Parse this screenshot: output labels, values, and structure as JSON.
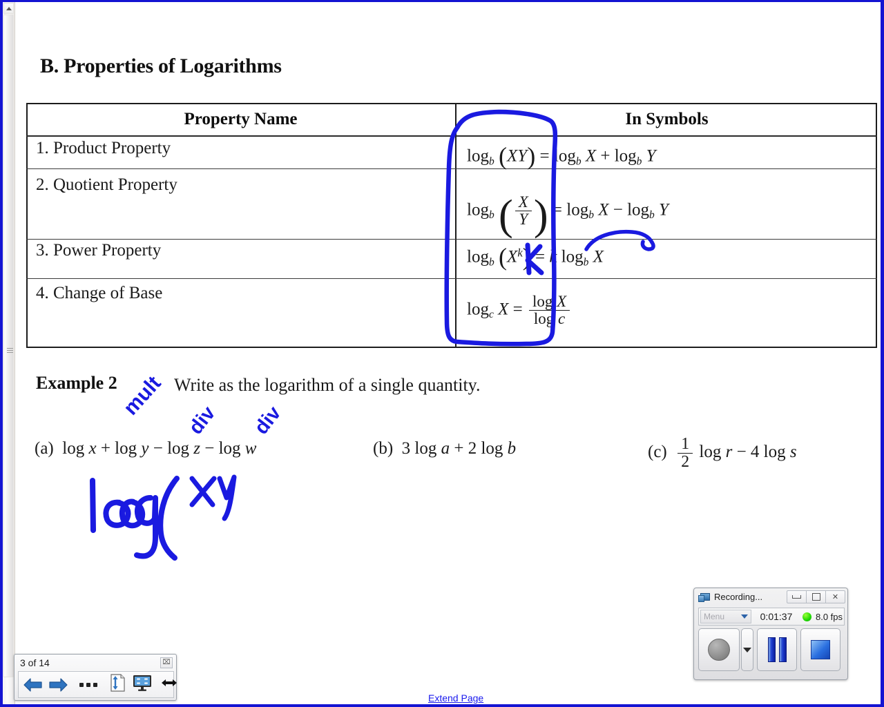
{
  "document": {
    "section_title": "B. Properties of Logarithms",
    "table": {
      "headers": [
        "Property Name",
        "In Symbols"
      ],
      "rows": [
        {
          "name": "1. Product Property",
          "symbols_plain": "log_b(XY) = log_b X + log_b Y"
        },
        {
          "name": "2. Quotient Property",
          "symbols_plain": "log_b(X/Y) = log_b X - log_b Y"
        },
        {
          "name": "3. Power Property",
          "symbols_plain": "log_b(X^k) = k log_b X"
        },
        {
          "name": "4. Change of Base",
          "symbols_plain": "log_c X = log X / log c"
        }
      ]
    },
    "example": {
      "label": "Example 2",
      "instruction": "Write as the logarithm of a single quantity.",
      "parts": [
        {
          "tag": "(a)",
          "expr_plain": "log x + log y - log z - log w"
        },
        {
          "tag": "(b)",
          "expr_plain": "3 log a + 2 log b"
        },
        {
          "tag": "(c)",
          "expr_plain": "1/2 log r - 4 log s"
        }
      ]
    },
    "annotations": {
      "ink_color": "#1a1ae0",
      "labels": [
        "mult",
        "div",
        "div",
        "k"
      ],
      "work": "log( xy"
    },
    "extend_page_link": "Extend Page"
  },
  "recorder": {
    "title": "Recording...",
    "menu_label": "Menu",
    "elapsed": "0:01:37",
    "fps": "8.0 fps",
    "status_color": "#1ed800",
    "window_buttons": [
      "minimize",
      "restore",
      "close"
    ],
    "close_glyph": "✕",
    "controls": [
      "record",
      "record-options",
      "pause",
      "stop"
    ]
  },
  "page_nav": {
    "page_indicator": "3 of 14",
    "close_glyph": "⌧",
    "buttons": [
      "previous-page",
      "next-page",
      "more-options",
      "fit-page",
      "presentation-mode",
      "fit-width"
    ]
  }
}
